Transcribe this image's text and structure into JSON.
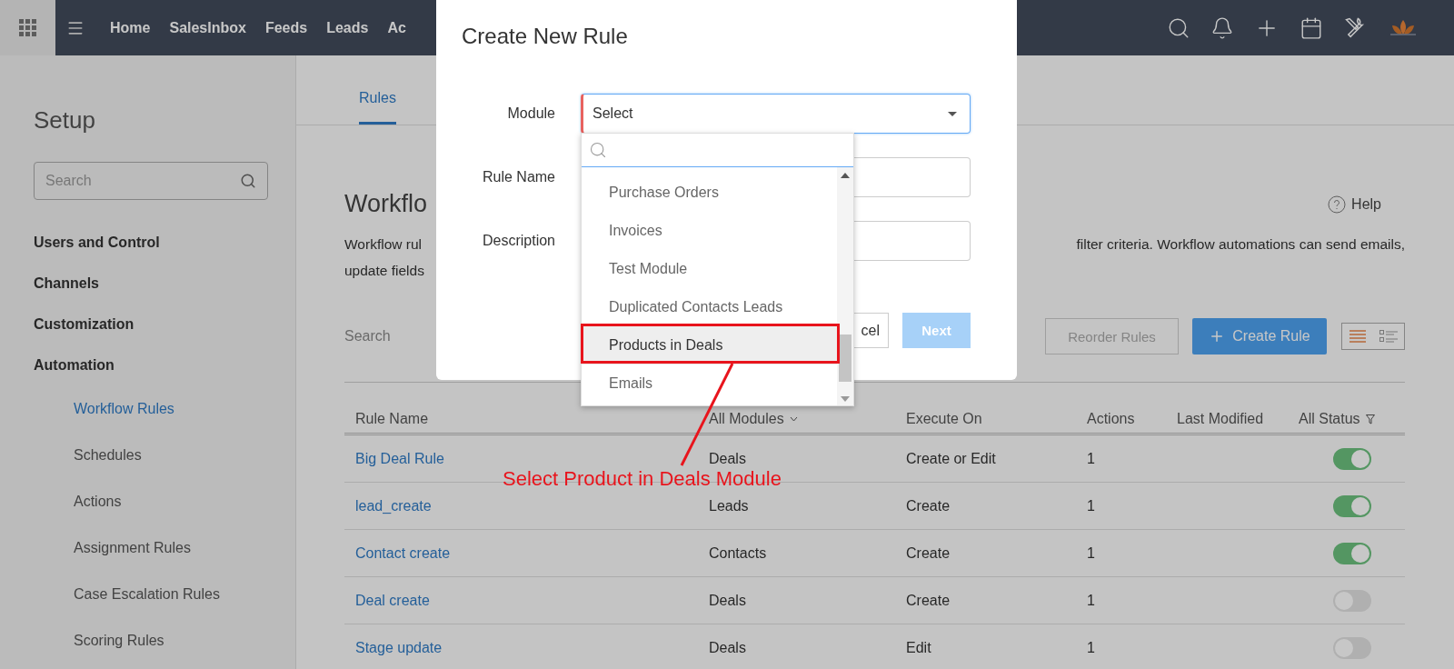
{
  "top_nav": {
    "items": [
      {
        "label": "Home"
      },
      {
        "label": "SalesInbox"
      },
      {
        "label": "Feeds"
      },
      {
        "label": "Leads"
      },
      {
        "label": "Ac"
      }
    ]
  },
  "sidebar": {
    "title": "Setup",
    "search_placeholder": "Search",
    "sections": [
      {
        "label": "Users and Control"
      },
      {
        "label": "Channels"
      },
      {
        "label": "Customization"
      },
      {
        "label": "Automation",
        "children": [
          {
            "label": "Workflow Rules",
            "selected": true
          },
          {
            "label": "Schedules",
            "selected": false
          },
          {
            "label": "Actions",
            "selected": false
          },
          {
            "label": "Assignment Rules",
            "selected": false
          },
          {
            "label": "Case Escalation Rules",
            "selected": false
          },
          {
            "label": "Scoring Rules",
            "selected": false
          }
        ]
      }
    ]
  },
  "tabs": [
    {
      "label": "Rules",
      "selected": true
    }
  ],
  "header": {
    "title": "Workflo",
    "help": "Help",
    "description_left": [
      "Workflow rul",
      "update fields"
    ],
    "description_right": "filter criteria. Workflow automations can send emails,"
  },
  "toolbar": {
    "search_placeholder": "Search",
    "reorder": "Reorder Rules",
    "create": "Create Rule",
    "views": [
      {
        "kind": "list",
        "selected": true
      },
      {
        "kind": "grid",
        "selected": false
      }
    ]
  },
  "table": {
    "columns": [
      "Rule Name",
      "All Modules",
      "Execute On",
      "Actions",
      "Last Modified",
      "All Status"
    ],
    "rows": [
      {
        "name": "Big Deal Rule",
        "module": "Deals",
        "execute_on": "Create or Edit",
        "actions": "1",
        "on": true
      },
      {
        "name": "lead_create",
        "module": "Leads",
        "execute_on": "Create",
        "actions": "1",
        "on": true
      },
      {
        "name": "Contact create",
        "module": "Contacts",
        "execute_on": "Create",
        "actions": "1",
        "on": true
      },
      {
        "name": "Deal create",
        "module": "Deals",
        "execute_on": "Create",
        "actions": "1",
        "on": false
      },
      {
        "name": "Stage update",
        "module": "Deals",
        "execute_on": "Edit",
        "actions": "1",
        "on": false
      }
    ]
  },
  "modal": {
    "title": "Create New Rule",
    "fields": [
      {
        "label": "Module",
        "value": "Select",
        "required": true,
        "kind": "select"
      },
      {
        "label": "Rule Name",
        "kind": "text"
      },
      {
        "label": "Description",
        "kind": "text"
      }
    ],
    "cancel": "cel",
    "next": {
      "label": "Next",
      "disabled": true
    }
  },
  "dropdown": {
    "items": [
      {
        "label": "Purchase Orders",
        "selected": false
      },
      {
        "label": "Invoices",
        "selected": false
      },
      {
        "label": "Test Module",
        "selected": false
      },
      {
        "label": "Duplicated Contacts Leads",
        "selected": false
      },
      {
        "label": "Products in Deals",
        "selected": true
      },
      {
        "label": "Emails",
        "selected": false
      }
    ]
  },
  "annotation": {
    "text": "Select Product in Deals Module"
  }
}
